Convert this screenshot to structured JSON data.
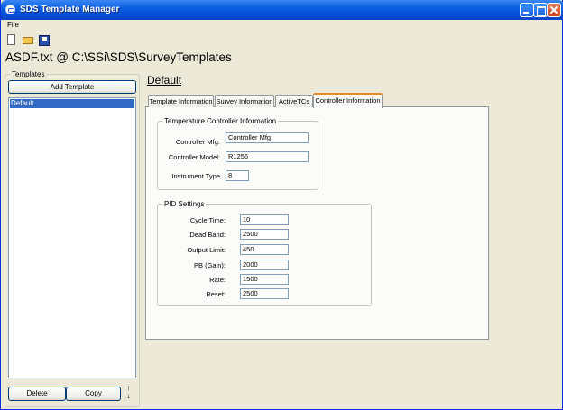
{
  "window": {
    "title": "SDS Template Manager"
  },
  "menu": {
    "file": "File"
  },
  "toolbar": {
    "new_icon": "new-document-icon",
    "open_icon": "open-folder-icon",
    "save_icon": "save-disk-icon"
  },
  "path_text": "ASDF.txt @ C:\\SSi\\SDS\\SurveyTemplates",
  "templates": {
    "group_label": "Templates",
    "add_button": "Add Template",
    "items": [
      "Default"
    ],
    "selected": "Default",
    "delete_button": "Delete",
    "copy_button": "Copy",
    "up_arrow": "↑",
    "down_arrow": "↓"
  },
  "detail": {
    "heading": "Default",
    "tabs": [
      "Template Information",
      "Survey Information",
      "ActiveTCs",
      "Controller Information"
    ],
    "active_tab": "Controller Information",
    "tc_group": {
      "label": "Temperature Controller Information",
      "mfg_label": "Controller Mfg:",
      "mfg_value": "Controller Mfg.",
      "model_label": "Controller Model:",
      "model_value": "R1256",
      "instr_label": "Instrument Type",
      "instr_value": "8"
    },
    "pid_group": {
      "label": "PID Settings",
      "fields": [
        {
          "label": "Cycle Time:",
          "value": "10"
        },
        {
          "label": "Dead Band:",
          "value": "2500"
        },
        {
          "label": "Output Limit:",
          "value": "450"
        },
        {
          "label": "PB (Gain):",
          "value": "2000"
        },
        {
          "label": "Rate:",
          "value": "1500"
        },
        {
          "label": "Reset:",
          "value": "2500"
        }
      ]
    }
  }
}
